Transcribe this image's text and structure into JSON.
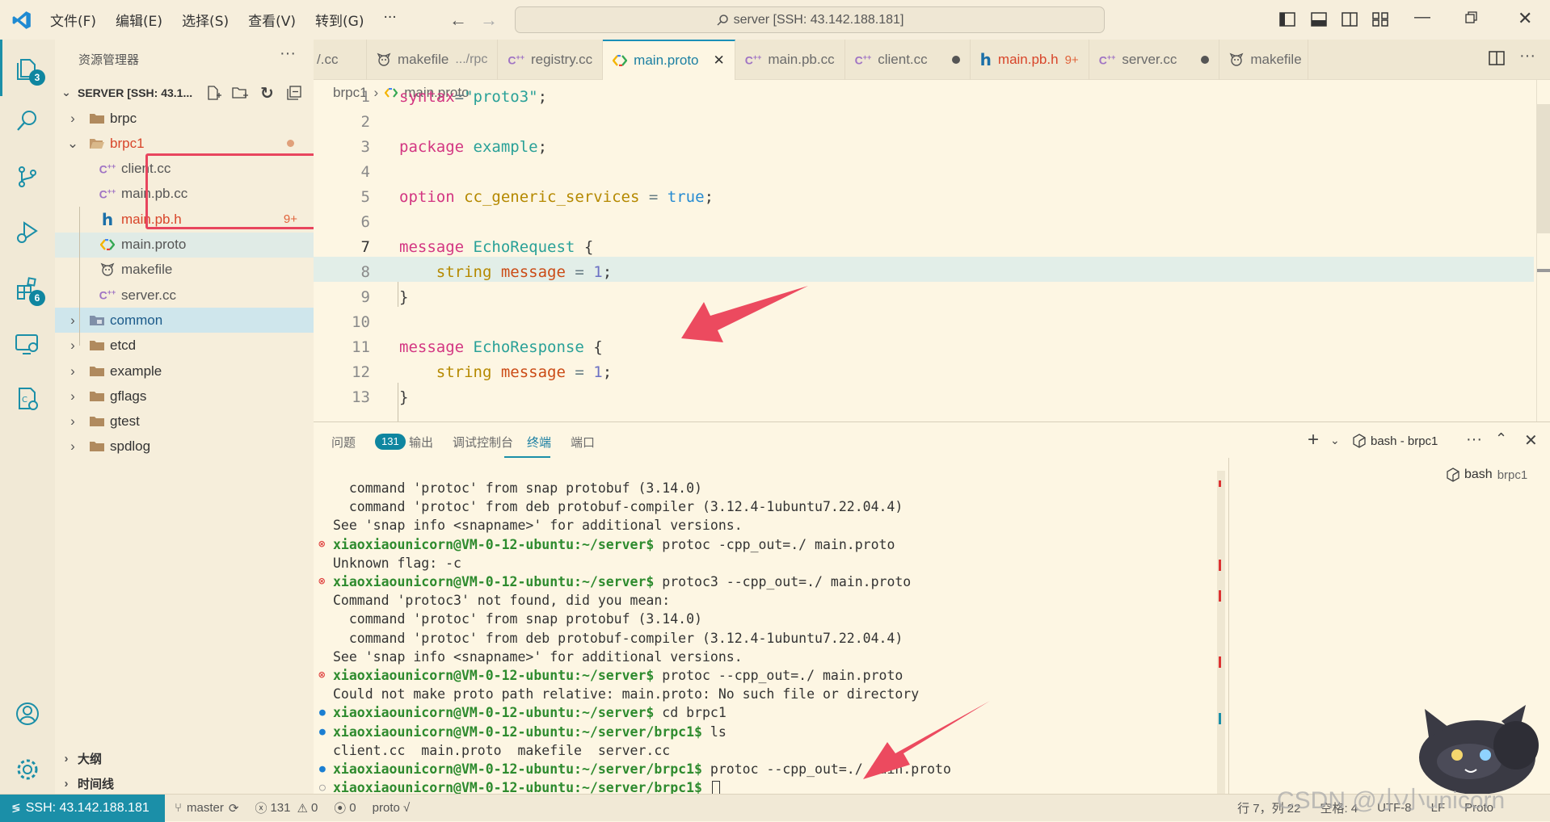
{
  "title_bar": {
    "menus": [
      "文件(F)",
      "编辑(E)",
      "选择(S)",
      "查看(V)",
      "转到(G)",
      "···"
    ],
    "search_text": "server [SSH: 43.142.188.181]"
  },
  "activity": {
    "explorer_badge": "3",
    "extensions_badge": "6"
  },
  "sidebar": {
    "header": "资源管理器",
    "more": "···",
    "root": "SERVER [SSH: 43.1...",
    "items": [
      {
        "label": "brpc",
        "type": "folder",
        "depth": 0
      },
      {
        "label": "brpc1",
        "type": "folder-open",
        "depth": 0
      },
      {
        "label": "client.cc",
        "type": "cpp",
        "depth": 1
      },
      {
        "label": "main.pb.cc",
        "type": "cpp",
        "depth": 1
      },
      {
        "label": "main.pb.h",
        "type": "h",
        "depth": 1,
        "badge": "9+"
      },
      {
        "label": "main.proto",
        "type": "proto",
        "depth": 1
      },
      {
        "label": "makefile",
        "type": "make",
        "depth": 1
      },
      {
        "label": "server.cc",
        "type": "cpp",
        "depth": 1
      },
      {
        "label": "common",
        "type": "folder-special",
        "depth": 0
      },
      {
        "label": "etcd",
        "type": "folder",
        "depth": 0
      },
      {
        "label": "example",
        "type": "folder",
        "depth": 0
      },
      {
        "label": "gflags",
        "type": "folder",
        "depth": 0
      },
      {
        "label": "gtest",
        "type": "folder",
        "depth": 0
      },
      {
        "label": "spdlog",
        "type": "folder",
        "depth": 0
      }
    ],
    "outline": "大纲",
    "timeline": "时间线"
  },
  "tabs": [
    {
      "label": "/.cc",
      "type": "cpp"
    },
    {
      "label": "makefile",
      "desc": ".../rpc",
      "type": "make"
    },
    {
      "label": "registry.cc",
      "type": "cpp"
    },
    {
      "label": "main.proto",
      "type": "proto",
      "active": true
    },
    {
      "label": "main.pb.cc",
      "type": "cpp"
    },
    {
      "label": "client.cc",
      "type": "cpp",
      "dirty": true
    },
    {
      "label": "main.pb.h",
      "type": "h",
      "badge": "9+"
    },
    {
      "label": "server.cc",
      "type": "cpp",
      "dirty": true
    },
    {
      "label": "makefile",
      "type": "make"
    }
  ],
  "breadcrumb": {
    "folder": "brpc1",
    "file": "main.proto"
  },
  "code_lines": [
    {
      "n": "1",
      "t": "syntax=\"proto3\";"
    },
    {
      "n": "2",
      "t": ""
    },
    {
      "n": "3",
      "t": "package example;"
    },
    {
      "n": "4",
      "t": ""
    },
    {
      "n": "5",
      "t": "option cc_generic_services = true;"
    },
    {
      "n": "6",
      "t": ""
    },
    {
      "n": "7",
      "t": "message EchoRequest {"
    },
    {
      "n": "8",
      "t": "    string message = 1;"
    },
    {
      "n": "9",
      "t": "}"
    },
    {
      "n": "10",
      "t": ""
    },
    {
      "n": "11",
      "t": "message EchoResponse {"
    },
    {
      "n": "12",
      "t": "    string message = 1;"
    },
    {
      "n": "13",
      "t": "}"
    }
  ],
  "panel": {
    "tabs": [
      "问题",
      "输出",
      "调试控制台",
      "终端",
      "端口"
    ],
    "problems_count": "131",
    "terminal_name": "bash - brpc1",
    "side_item": "bash",
    "side_item_desc": "brpc1"
  },
  "terminal": [
    {
      "m": "none",
      "p": "",
      "t": "  command 'protoc' from snap protobuf (3.14.0)"
    },
    {
      "m": "none",
      "p": "",
      "t": "  command 'protoc' from deb protobuf-compiler (3.12.4-1ubuntu7.22.04.4)"
    },
    {
      "m": "none",
      "p": "",
      "t": "See 'snap info <snapname>' for additional versions."
    },
    {
      "m": "err",
      "p": "xiaoxiaounicorn@VM-0-12-ubuntu:~/server$",
      "t": " protoc -cpp_out=./ main.proto"
    },
    {
      "m": "none",
      "p": "",
      "t": "Unknown flag: -c"
    },
    {
      "m": "err",
      "p": "xiaoxiaounicorn@VM-0-12-ubuntu:~/server$",
      "t": " protoc3 --cpp_out=./ main.proto"
    },
    {
      "m": "none",
      "p": "",
      "t": "Command 'protoc3' not found, did you mean:"
    },
    {
      "m": "none",
      "p": "",
      "t": "  command 'protoc' from snap protobuf (3.14.0)"
    },
    {
      "m": "none",
      "p": "",
      "t": "  command 'protoc' from deb protobuf-compiler (3.12.4-1ubuntu7.22.04.4)"
    },
    {
      "m": "none",
      "p": "",
      "t": "See 'snap info <snapname>' for additional versions."
    },
    {
      "m": "err",
      "p": "xiaoxiaounicorn@VM-0-12-ubuntu:~/server$",
      "t": " protoc --cpp_out=./ main.proto"
    },
    {
      "m": "none",
      "p": "",
      "t": "Could not make proto path relative: main.proto: No such file or directory"
    },
    {
      "m": "ok",
      "p": "xiaoxiaounicorn@VM-0-12-ubuntu:~/server$",
      "t": " cd brpc1"
    },
    {
      "m": "ok",
      "p": "xiaoxiaounicorn@VM-0-12-ubuntu:~/server/brpc1$",
      "t": " ls"
    },
    {
      "m": "none",
      "p": "",
      "t": "client.cc  main.proto  makefile  server.cc"
    },
    {
      "m": "ok",
      "p": "xiaoxiaounicorn@VM-0-12-ubuntu:~/server/brpc1$",
      "t": " protoc --cpp_out=./ main.proto"
    },
    {
      "m": "idle",
      "p": "xiaoxiaounicorn@VM-0-12-ubuntu:~/server/brpc1$",
      "t": " "
    }
  ],
  "status": {
    "remote": "SSH: 43.142.188.181",
    "branch": "master",
    "errors": "131",
    "warnings": "0",
    "ports": "0",
    "lang_check": "proto √",
    "position": "行 7，列 22",
    "spaces": "空格: 4",
    "encoding": "UTF-8",
    "eol": "LF",
    "language": "Proto",
    "watermark": "CSDN @小小unicorn"
  },
  "colors": {
    "accent": "#1b8fa8",
    "highlight_box": "#e8455e",
    "arrow": "#ec4a5f"
  }
}
